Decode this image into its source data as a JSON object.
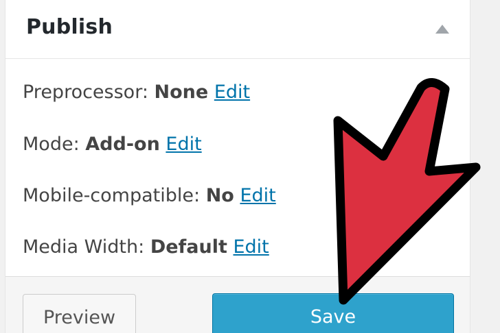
{
  "publish_box": {
    "title": "Publish",
    "rows": [
      {
        "label": "Preprocessor:",
        "value": "None",
        "edit": "Edit"
      },
      {
        "label": "Mode:",
        "value": "Add-on",
        "edit": "Edit"
      },
      {
        "label": "Mobile-compatible:",
        "value": "No",
        "edit": "Edit"
      },
      {
        "label": "Media Width:",
        "value": "Default",
        "edit": "Edit"
      }
    ],
    "preview_label": "Preview",
    "save_label": "Save"
  },
  "icons": {
    "collapse": "triangle-up-icon",
    "annotation": "red-arrow-icon"
  },
  "colors": {
    "link": "#0073aa",
    "save_button": "#2ea2cc",
    "arrow_fill": "#dc3040",
    "arrow_stroke": "#000000"
  }
}
